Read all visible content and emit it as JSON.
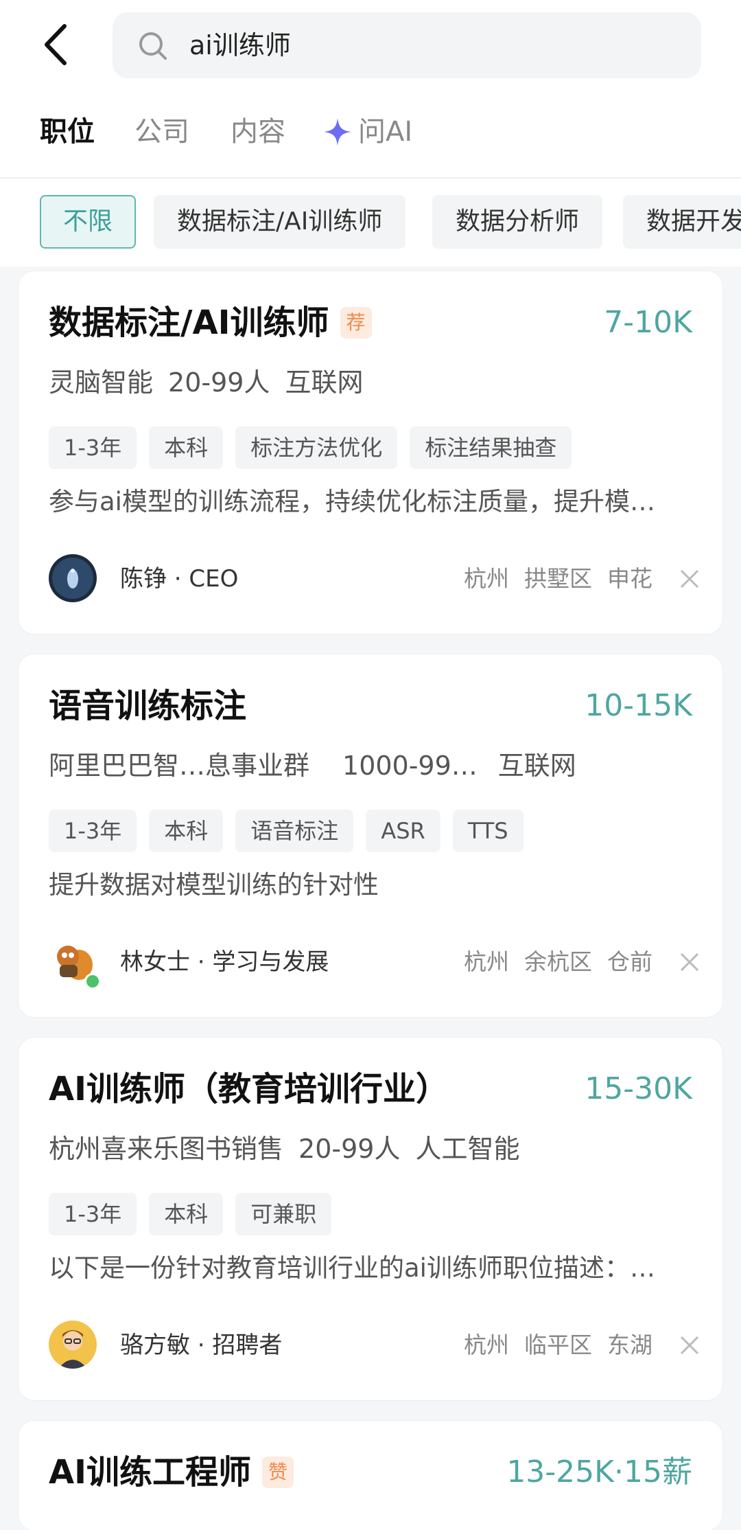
{
  "search": {
    "query": "ai训练师"
  },
  "tabs": [
    {
      "label": "职位",
      "active": true
    },
    {
      "label": "公司",
      "active": false
    },
    {
      "label": "内容",
      "active": false
    },
    {
      "label": "问AI",
      "active": false,
      "icon": "sparkle-icon"
    }
  ],
  "filter_chips": [
    {
      "label": "不限",
      "active": true
    },
    {
      "label": "数据标注/AI训练师",
      "active": false
    },
    {
      "label": "数据分析师",
      "active": false
    },
    {
      "label": "数据开发",
      "active": false
    }
  ],
  "jobs": [
    {
      "title": "数据标注/AI训练师",
      "badge": "荐",
      "salary": "7-10K",
      "company": "灵脑智能",
      "size": "20-99人",
      "industry": "互联网",
      "tags": [
        "1-3年",
        "本科",
        "标注方法优化",
        "标注结果抽查"
      ],
      "description": "参与ai模型的训练流程，持续优化标注质量，提升模…",
      "recruiter": "陈铮 · CEO",
      "location": [
        "杭州",
        "拱墅区",
        "申花"
      ]
    },
    {
      "title": "语音训练标注",
      "badge": "",
      "salary": "10-15K",
      "company": "阿里巴巴智…息事业群",
      "size": "1000-99…",
      "industry": "互联网",
      "tags": [
        "1-3年",
        "本科",
        "语音标注",
        "ASR",
        "TTS"
      ],
      "description": "提升数据对模型训练的针对性",
      "recruiter": "林女士 · 学习与发展",
      "online": true,
      "location": [
        "杭州",
        "余杭区",
        "仓前"
      ]
    },
    {
      "title": "AI训练师（教育培训行业）",
      "badge": "",
      "salary": "15-30K",
      "company": "杭州喜来乐图书销售",
      "size": "20-99人",
      "industry": "人工智能",
      "tags": [
        "1-3年",
        "本科",
        "可兼职"
      ],
      "description": "以下是一份针对教育培训行业的ai训练师职位描述：…",
      "recruiter": "骆方敏 · 招聘者",
      "location": [
        "杭州",
        "临平区",
        "东湖"
      ]
    },
    {
      "title": "AI训练工程师",
      "badge": "赞",
      "salary": "13-25K·15薪"
    }
  ],
  "colors": {
    "accent": "#4ea6a0",
    "badge": "#f08a4b",
    "sparkle": "#6b6ef5"
  }
}
